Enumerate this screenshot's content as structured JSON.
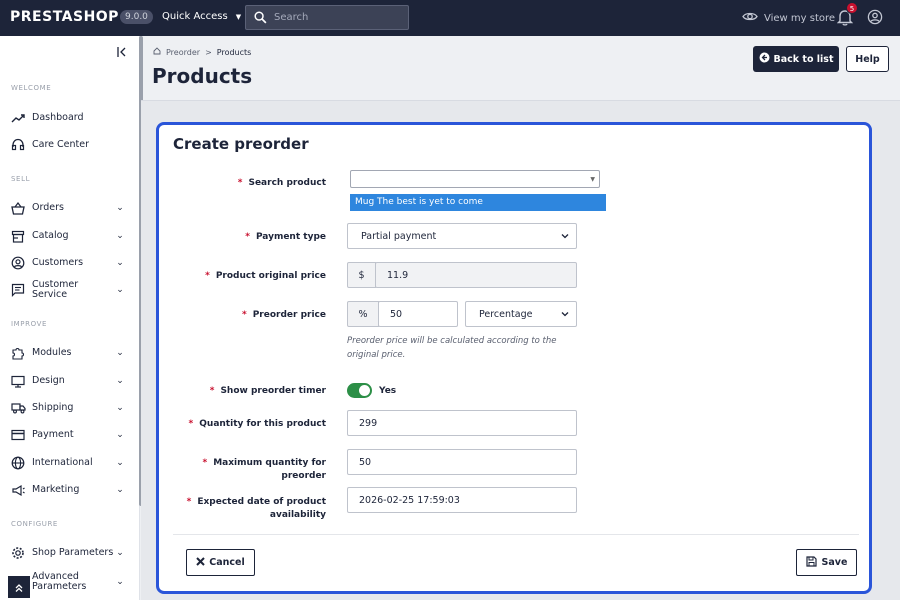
{
  "topbar": {
    "logo": "PRESTASHOP",
    "version": "9.0.0",
    "quick_access": "Quick Access",
    "search_placeholder": "Search",
    "view_store": "View my store",
    "notification_count": "5"
  },
  "sidebar": {
    "sections": {
      "welcome": "WELCOME",
      "sell": "SELL",
      "improve": "IMPROVE",
      "configure": "CONFIGURE"
    },
    "items": [
      {
        "label": "Dashboard",
        "icon": "trending-up-icon"
      },
      {
        "label": "Care Center",
        "icon": "headset-icon"
      },
      {
        "label": "Orders",
        "icon": "basket-icon"
      },
      {
        "label": "Catalog",
        "icon": "store-icon"
      },
      {
        "label": "Customers",
        "icon": "account-circle-icon"
      },
      {
        "label": "Customer Service",
        "icon": "chat-icon"
      },
      {
        "label": "Modules",
        "icon": "puzzle-icon"
      },
      {
        "label": "Design",
        "icon": "desktop-icon"
      },
      {
        "label": "Shipping",
        "icon": "truck-icon"
      },
      {
        "label": "Payment",
        "icon": "credit-card-icon"
      },
      {
        "label": "International",
        "icon": "globe-icon"
      },
      {
        "label": "Marketing",
        "icon": "megaphone-icon"
      },
      {
        "label": "Shop Parameters",
        "icon": "gear-icon"
      },
      {
        "label": "Advanced Parameters",
        "icon": "gear-icon"
      }
    ]
  },
  "header": {
    "breadcrumb": [
      "Preorder",
      "Products"
    ],
    "title": "Products",
    "back_button": "Back to list",
    "help_button": "Help"
  },
  "modal": {
    "title": "Create preorder",
    "fields": {
      "search_product": {
        "label": "Search product",
        "value": "",
        "option": "Mug The best is yet to come"
      },
      "payment_type": {
        "label": "Payment type",
        "value": "Partial payment"
      },
      "original_price": {
        "label": "Product original price",
        "currency": "$",
        "value": "11.9"
      },
      "preorder_price": {
        "label": "Preorder price",
        "addon": "%",
        "value": "50",
        "type": "Percentage",
        "help": "Preorder price will be calculated according to the original price."
      },
      "show_timer": {
        "label": "Show preorder timer",
        "value": "Yes"
      },
      "quantity": {
        "label": "Quantity for this product",
        "value": "299"
      },
      "max_quantity": {
        "label": "Maximum quantity for preorder",
        "value": "50"
      },
      "expected_date": {
        "label_line1": "Expected date of product",
        "label_line2": "availability",
        "value": "2026-02-25 17:59:03"
      }
    },
    "cancel_button": "Cancel",
    "save_button": "Save"
  },
  "colors": {
    "topbar_bg": "#1d2439",
    "accent_border": "#2a55d9",
    "toggle_on": "#2c8f47",
    "dropdown_highlight": "#2e86de",
    "required": "#c8102e"
  }
}
